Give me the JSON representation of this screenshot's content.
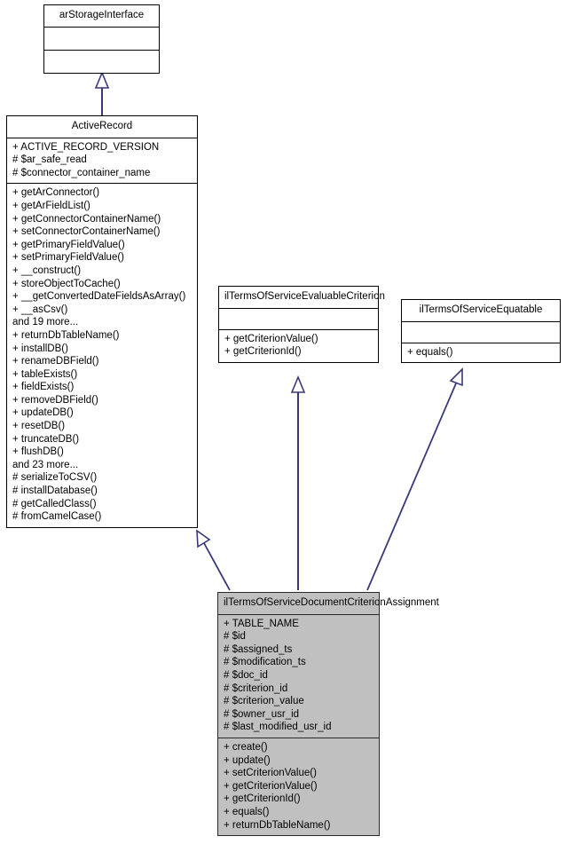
{
  "diagram": {
    "kind": "uml-class-diagram",
    "background": "#ffffff",
    "edge_color": "#39397a",
    "highlight_fill": "#c0c0c0",
    "border_color": "#000000"
  },
  "classes": {
    "arstorageinterface": {
      "name": "arStorageInterface",
      "attributes": [],
      "methods": []
    },
    "activerecord": {
      "name": "ActiveRecord",
      "attributes": [
        "+ ACTIVE_RECORD_VERSION",
        "# $ar_safe_read",
        "# $connector_container_name"
      ],
      "methods": [
        "+ getArConnector()",
        "+ getArFieldList()",
        "+ getConnectorContainerName()",
        "+ setConnectorContainerName()",
        "+ getPrimaryFieldValue()",
        "+ setPrimaryFieldValue()",
        "+ __construct()",
        "+ storeObjectToCache()",
        "+ __getConvertedDateFieldsAsArray()",
        "+ __asCsv()",
        "and 19 more...",
        "+ returnDbTableName()",
        "+ installDB()",
        "+ renameDBField()",
        "+ tableExists()",
        "+ fieldExists()",
        "+ removeDBField()",
        "+ updateDB()",
        "+ resetDB()",
        "+ truncateDB()",
        "+ flushDB()",
        "and 23 more...",
        "# serializeToCSV()",
        "# installDatabase()",
        "# getCalledClass()",
        "# fromCamelCase()"
      ]
    },
    "evaluablecriterion": {
      "name": "ilTermsOfServiceEvaluableCriterion",
      "attributes": [],
      "methods": [
        "+ getCriterionValue()",
        "+ getCriterionId()"
      ]
    },
    "equatable": {
      "name": "ilTermsOfServiceEquatable",
      "attributes": [],
      "methods": [
        "+ equals()"
      ]
    },
    "assignment": {
      "name": "ilTermsOfServiceDocumentCriterionAssignment",
      "attributes": [
        "+ TABLE_NAME",
        "# $id",
        "# $assigned_ts",
        "# $modification_ts",
        "# $doc_id",
        "# $criterion_id",
        "# $criterion_value",
        "# $owner_usr_id",
        "# $last_modified_usr_id"
      ],
      "methods": [
        "+ create()",
        "+ update()",
        "+ setCriterionValue()",
        "+ getCriterionValue()",
        "+ getCriterionId()",
        "+ equals()",
        "+ returnDbTableName()"
      ]
    }
  },
  "relations": [
    {
      "name": "activerecord-implements-arstorageinterface",
      "type": "generalization",
      "from": "ActiveRecord",
      "to": "arStorageInterface"
    },
    {
      "name": "assignment-extends-activerecord",
      "type": "generalization",
      "from": "ilTermsOfServiceDocumentCriterionAssignment",
      "to": "ActiveRecord"
    },
    {
      "name": "assignment-implements-evaluablecriterion",
      "type": "generalization",
      "from": "ilTermsOfServiceDocumentCriterionAssignment",
      "to": "ilTermsOfServiceEvaluableCriterion"
    },
    {
      "name": "assignment-implements-equatable",
      "type": "generalization",
      "from": "ilTermsOfServiceDocumentCriterionAssignment",
      "to": "ilTermsOfServiceEquatable"
    }
  ]
}
